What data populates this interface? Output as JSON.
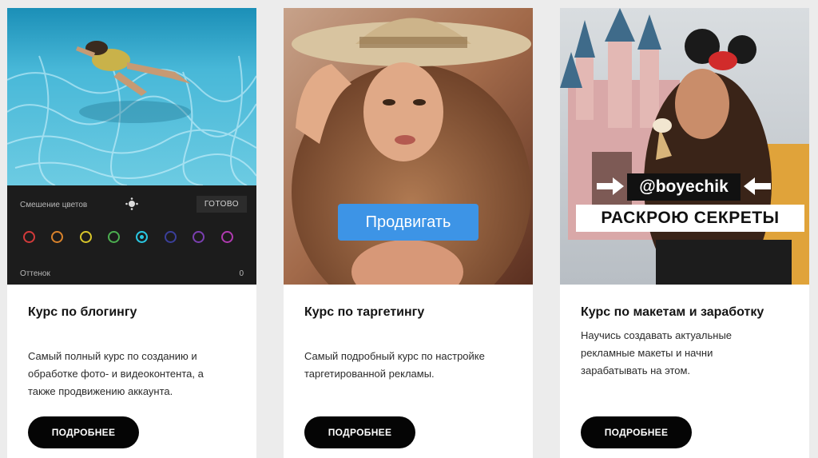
{
  "cards": [
    {
      "title": "Курс по блогингу",
      "description": "Самый полный курс по созданию и обработке фото- и видеоконтента, а также продвижению аккаунта.",
      "button": "ПОДРОБНЕЕ",
      "image": {
        "panel_label": "Смешение цветов",
        "done_label": "ГОТОВО",
        "hue_label": "Оттенок",
        "hue_value": "0",
        "swatch_colors": [
          "#d23a3a",
          "#d9822b",
          "#d8c62a",
          "#4caf50",
          "#29c6e0",
          "#3a3f9a",
          "#7a3fb0",
          "#b03ab0"
        ],
        "selected_swatch": 4
      }
    },
    {
      "title": "Курс по таргетингу",
      "description": "Самый подробный курс по настройке таргетированной рекламы.",
      "button": "ПОДРОБНЕЕ",
      "image": {
        "overlay_button": "Продвигать",
        "overlay_color": "#3d94e6"
      }
    },
    {
      "title": "Курс по макетам и заработку",
      "description": "Научись создавать актуальные рекламные макеты и начни зарабатывать на этом.",
      "button": "ПОДРОБНЕЕ",
      "image": {
        "handle": "@boyechik",
        "caption": "РАСКРОЮ СЕКРЕТЫ"
      }
    }
  ]
}
